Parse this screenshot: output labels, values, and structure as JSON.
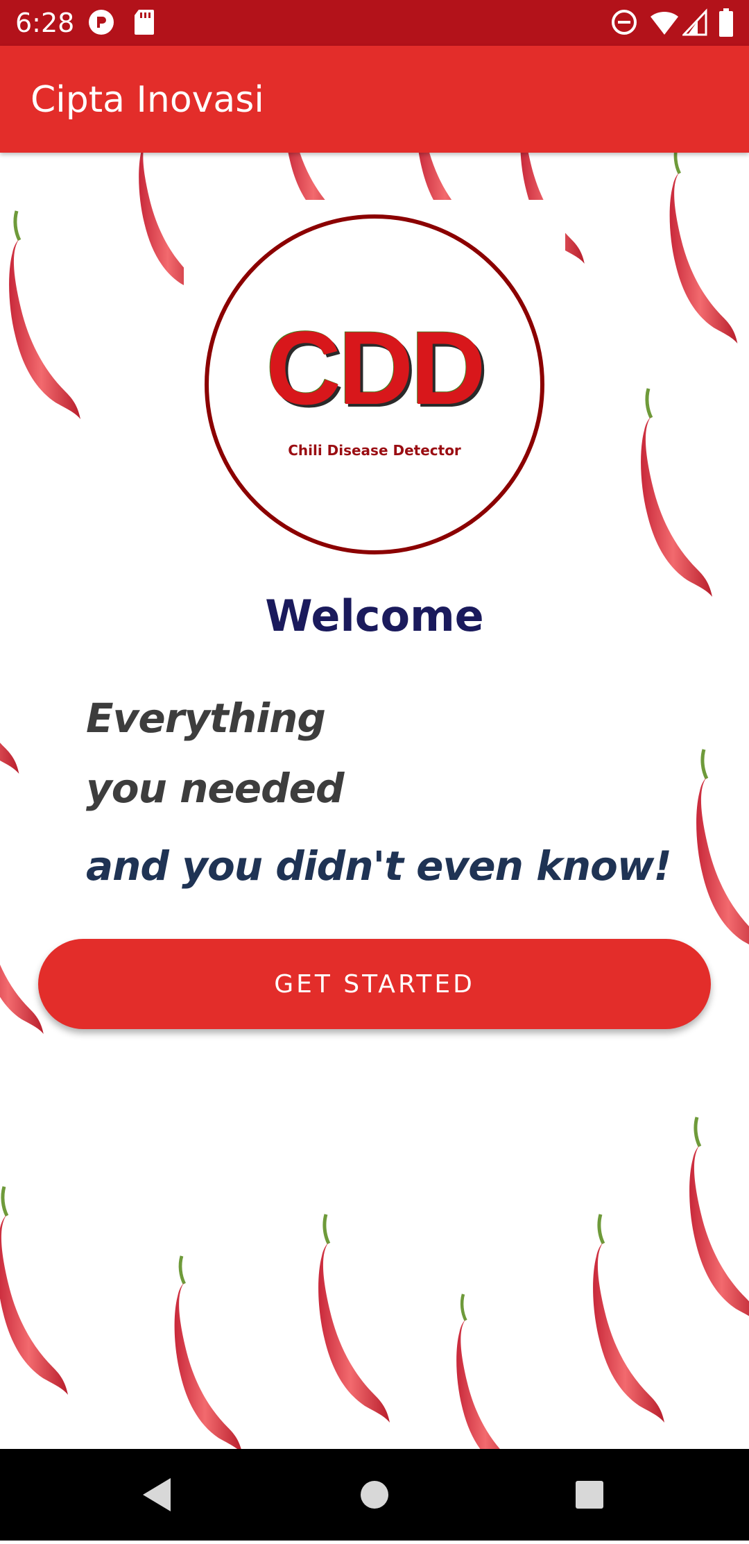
{
  "status_bar": {
    "time": "6:28",
    "icons": [
      "app-notification-icon",
      "sd-card-icon",
      "do-not-disturb-icon",
      "wifi-icon",
      "cell-signal-icon",
      "battery-icon"
    ]
  },
  "app_bar": {
    "title": "Cipta Inovasi",
    "color": "#e32d2a"
  },
  "logo": {
    "text": "CDD",
    "subtitle": "Chili Disease Detector",
    "ring_color": "#8b0000"
  },
  "content": {
    "welcome": "Welcome",
    "tagline_1": "Everything",
    "tagline_2": "you needed",
    "tagline_3": "and you didn't even know!",
    "welcome_color": "#1a1a5c"
  },
  "button": {
    "label": "GET STARTED",
    "color": "#e32d2a"
  },
  "nav_bar": {
    "icons": [
      "back-icon",
      "home-icon",
      "recents-icon"
    ]
  }
}
